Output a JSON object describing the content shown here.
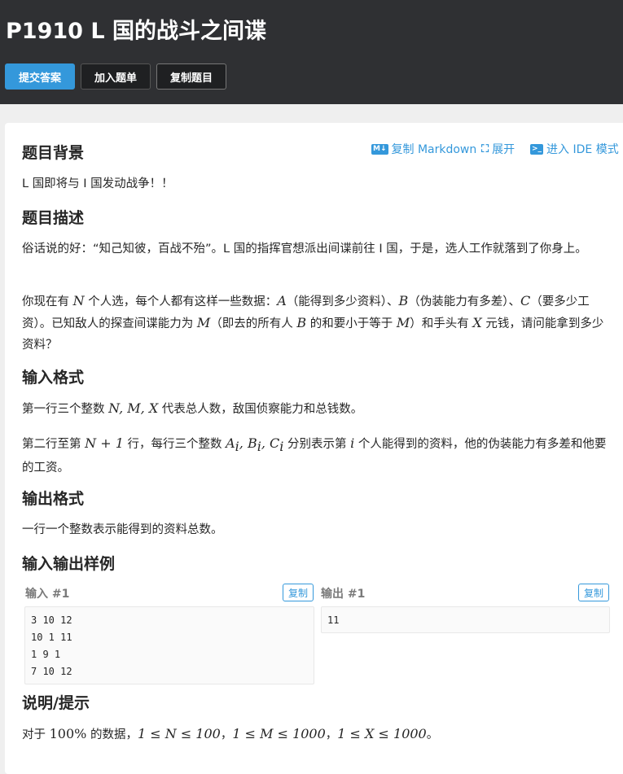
{
  "header": {
    "title": "P1910 L 国的战斗之间谍",
    "buttons": {
      "submit": "提交答案",
      "add": "加入题单",
      "copy": "复制题目"
    }
  },
  "toolbar": {
    "markdown_icon": "M↓",
    "markdown": "复制 Markdown",
    "expand_icon": "⛶",
    "expand": "展开",
    "ide_icon": ">_",
    "ide": "进入 IDE 模式"
  },
  "sections": {
    "background": {
      "title": "题目背景",
      "text": "L 国即将与 I 国发动战争！！"
    },
    "description": {
      "title": "题目描述",
      "p1": "俗话说的好：“知己知彼，百战不殆”。L 国的指挥官想派出间谍前往 I 国，于是，选人工作就落到了你身上。",
      "p2": {
        "t1": "你现在有 ",
        "N": "N",
        "t2": " 个人选，每个人都有这样一些数据：",
        "A": "A",
        "t3": "（能得到多少资料）、",
        "B": "B",
        "t4": "（伪装能力有多差）、",
        "C": "C",
        "t5": "（要多少工资）。已知敌人的探查间谍能力为 ",
        "M": "M",
        "t6": "（即去的所有人 ",
        "B2": "B",
        "t7": " 的和要小于等于 ",
        "M2": "M",
        "t8": "）和手头有 ",
        "X": "X",
        "t9": " 元钱，请问能拿到多少资料？"
      }
    },
    "input": {
      "title": "输入格式",
      "p1": {
        "t1": "第一行三个整数 ",
        "vars": "N, M, X",
        "t2": " 代表总人数，敌国侦察能力和总钱数。"
      },
      "p2": {
        "t1": "第二行至第 ",
        "expr": "N + 1",
        "t2": " 行，每行三个整数 ",
        "vars": "A",
        "i1": "i",
        "comma1": ", B",
        "i2": "i",
        "comma2": ", C",
        "i3": "i",
        "t3": " 分别表示第 ",
        "i": "i",
        "t4": " 个人能得到的资料，他的伪装能力有多差和他要的工资。"
      }
    },
    "output": {
      "title": "输出格式",
      "text": "一行一个整数表示能得到的资料总数。"
    },
    "samples": {
      "title": "输入输出样例",
      "input_label": "输入 #1",
      "output_label": "输出 #1",
      "copy": "复制",
      "input_lines": [
        "3 10 12",
        "10 1 11",
        "1 9 1",
        "7 10 12"
      ],
      "output_lines": [
        "11"
      ]
    },
    "hint": {
      "title": "说明/提示",
      "t1": "对于 ",
      "pct": "100%",
      "t2": " 的数据，",
      "c1": "1 ≤ N ≤ 100",
      "sep": "，",
      "c2": "1 ≤ M ≤ 1000",
      "c3": "1 ≤ X ≤ 1000",
      "end": "。"
    }
  }
}
